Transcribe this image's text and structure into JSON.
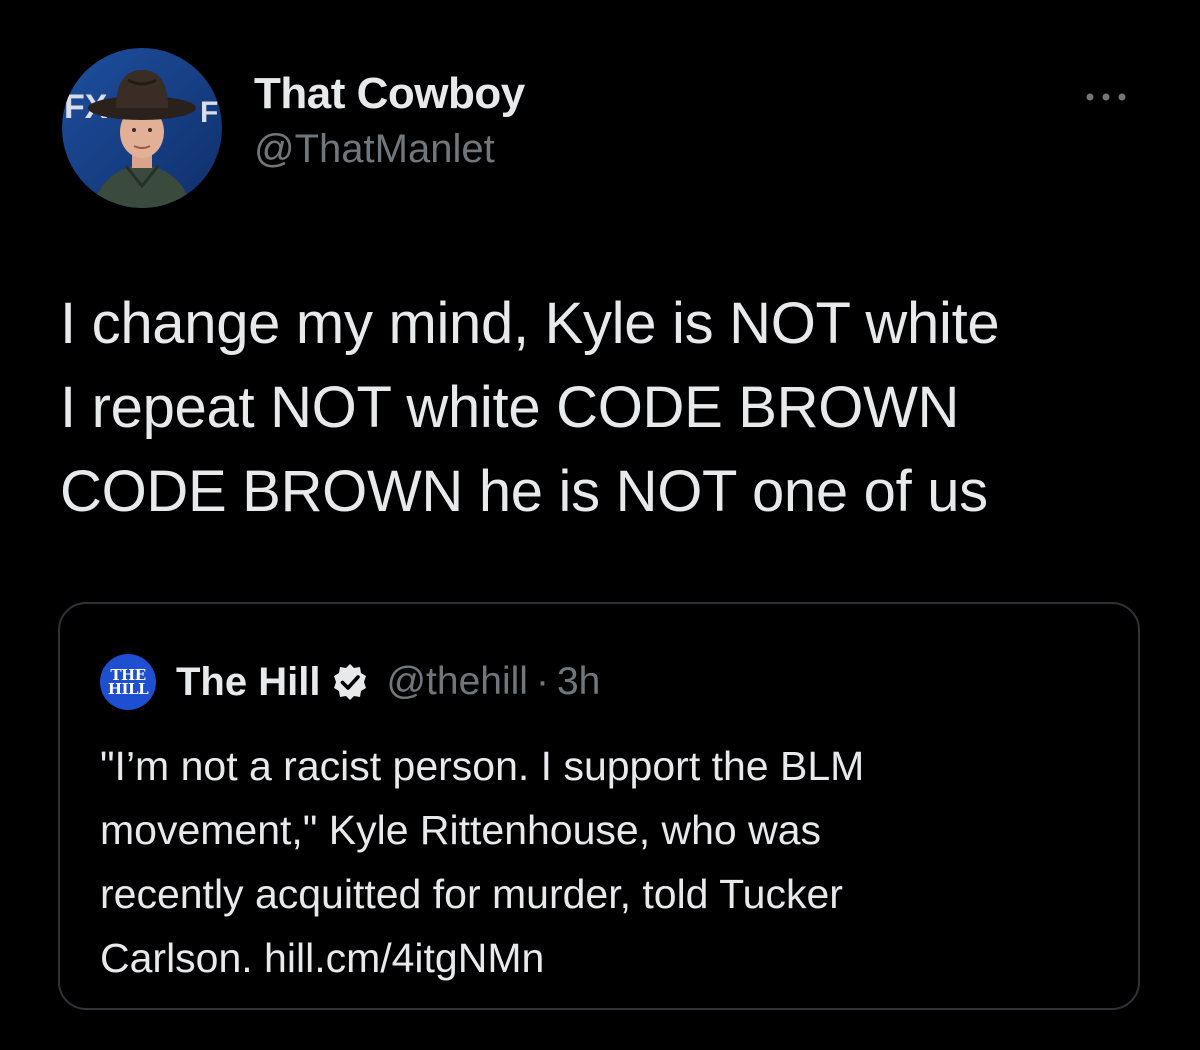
{
  "tweet": {
    "author": {
      "display_name": "That Cowboy",
      "handle": "@ThatManlet",
      "avatar_icon": "profile-photo-cowboy"
    },
    "more_icon": "more-options-icon",
    "text": "I change my mind, Kyle is NOT white\nI repeat NOT white CODE BROWN\nCODE BROWN he is NOT one of us"
  },
  "quote": {
    "author": {
      "display_name": "The Hill",
      "handle": "@thehill",
      "separator": "·",
      "time": "3h",
      "verified": true,
      "avatar_line1": "THE",
      "avatar_line2": "HILL"
    },
    "text": "\"I’m not a racist person. I support the BLM\nmovement,\" Kyle Rittenhouse, who was\nrecently acquitted for murder, told Tucker\nCarlson. hill.cm/4itgNMn"
  },
  "colors": {
    "background": "#000000",
    "text_primary": "#e7e9ea",
    "text_secondary": "#71767b",
    "border": "#2f3336",
    "the_hill_brand": "#1d4fd0"
  }
}
